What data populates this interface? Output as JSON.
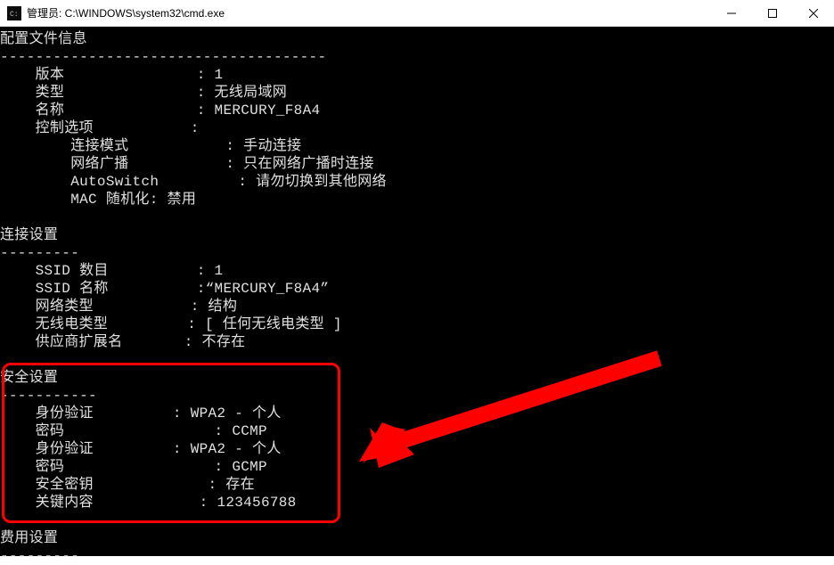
{
  "window": {
    "title": "管理员: C:\\WINDOWS\\system32\\cmd.exe"
  },
  "sections": {
    "config_info": {
      "header": "配置文件信息",
      "dash": "-------------------------------------",
      "lines": [
        {
          "label": "    版本",
          "colon": "               :",
          "value": " 1"
        },
        {
          "label": "    类型",
          "colon": "               :",
          "value": " 无线局域网"
        },
        {
          "label": "    名称",
          "colon": "               :",
          "value": " MERCURY_F8A4"
        },
        {
          "label": "    控制选项",
          "colon": "           :",
          "value": ""
        },
        {
          "label": "        连接模式",
          "colon": "           :",
          "value": " 手动连接"
        },
        {
          "label": "        网络广播",
          "colon": "           :",
          "value": " 只在网络广播时连接"
        },
        {
          "label": "        AutoSwitch",
          "colon": "         :",
          "value": " 请勿切换到其他网络"
        },
        {
          "label": "        MAC 随机化: 禁用",
          "colon": "",
          "value": ""
        }
      ]
    },
    "conn_settings": {
      "header": "连接设置",
      "dash": "---------",
      "lines": [
        {
          "label": "    SSID 数目",
          "colon": "          :",
          "value": " 1"
        },
        {
          "label": "    SSID 名称",
          "colon": "          :",
          "value": "“MERCURY_F8A4”"
        },
        {
          "label": "    网络类型",
          "colon": "           :",
          "value": " 结构"
        },
        {
          "label": "    无线电类型",
          "colon": "         :",
          "value": " [ 任何无线电类型 ]"
        },
        {
          "label": "    供应商扩展名",
          "colon": "       :",
          "value": " 不存在"
        }
      ]
    },
    "security": {
      "header": "安全设置",
      "dash": "-----------",
      "lines": [
        {
          "label": "    身份验证",
          "colon": "         :",
          "value": " WPA2 - 个人"
        },
        {
          "label": "    密码",
          "colon": "                 :",
          "value": " CCMP"
        },
        {
          "label": "    身份验证",
          "colon": "         :",
          "value": " WPA2 - 个人"
        },
        {
          "label": "    密码",
          "colon": "                 :",
          "value": " GCMP"
        },
        {
          "label": "    安全密钥",
          "colon": "             :",
          "value": " 存在"
        },
        {
          "label": "    关键内容",
          "colon": "            :",
          "value": " 123456788"
        }
      ]
    },
    "cost_settings": {
      "header": "费用设置",
      "dash": "---------"
    }
  }
}
